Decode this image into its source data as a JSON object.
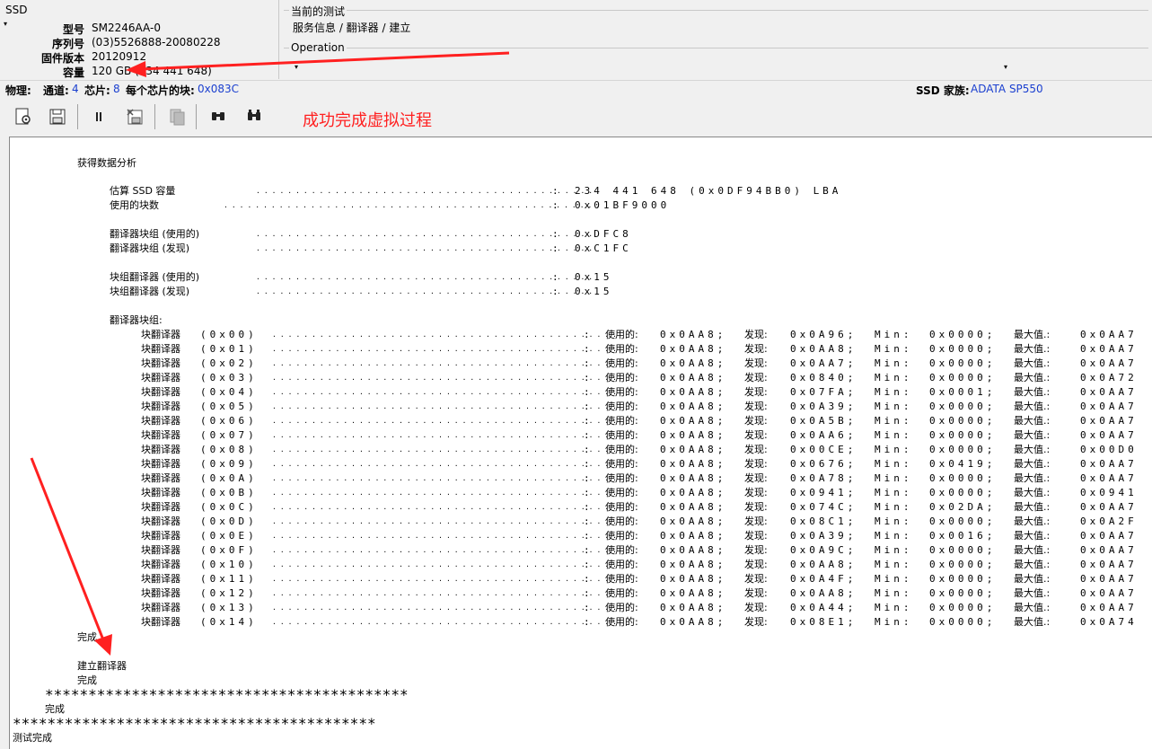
{
  "ssd": {
    "caption": "SSD",
    "dropdown_glyph": "▾",
    "fields": [
      {
        "label": "型号",
        "value": "SM2246AA-0"
      },
      {
        "label": "序列号",
        "value": "(03)5526888-20080228"
      },
      {
        "label": "固件版本",
        "value": "20120912"
      },
      {
        "label": "容量",
        "value": "120 GB (234 441 648)"
      }
    ]
  },
  "current_test": {
    "title": "当前的测试",
    "path": "服务信息 / 翻译器 / 建立"
  },
  "operation": {
    "title": "Operation",
    "selected": ""
  },
  "physical": {
    "label": "物理:",
    "channels_label": "通道:",
    "channels": "4",
    "chips_label": "芯片:",
    "chips": "8",
    "blocks_label": "每个芯片的块:",
    "blocks": "0x083C",
    "family_label": "SSD 家族:",
    "family": "ADATA SP550"
  },
  "toolbar": {
    "annotation": "成功完成虚拟过程",
    "annotation_color": "#ff2020"
  },
  "log": {
    "heading": "获得数据分析",
    "summary": [
      {
        "label": "估算 SSD 容量",
        "value": "234 441 648 (0x0DF94BB0) LBA"
      },
      {
        "label": "使用的块数",
        "value": "0x01BF9000"
      },
      {
        "label": "翻译器块组 (使用的)",
        "value": "0xDFC8"
      },
      {
        "label": "翻译器块组 (发现)",
        "value": "0xC1FC"
      },
      {
        "label": "块组翻译器 (使用的)",
        "value": "0x15"
      },
      {
        "label": "块组翻译器 (发现)",
        "value": "0x15"
      }
    ],
    "groups_heading": "翻译器块组:",
    "col_used": "使用的:",
    "col_found": "发现:",
    "col_min": "Min:",
    "col_max": "最大值.:",
    "translator_label": "块翻译器",
    "translators": [
      {
        "id": "(0x00)",
        "used": "0x0AA8;",
        "found": "0x0A96;",
        "min": "0x0000;",
        "max": "0x0AA7"
      },
      {
        "id": "(0x01)",
        "used": "0x0AA8;",
        "found": "0x0AA8;",
        "min": "0x0000;",
        "max": "0x0AA7"
      },
      {
        "id": "(0x02)",
        "used": "0x0AA8;",
        "found": "0x0AA7;",
        "min": "0x0000;",
        "max": "0x0AA7"
      },
      {
        "id": "(0x03)",
        "used": "0x0AA8;",
        "found": "0x0840;",
        "min": "0x0000;",
        "max": "0x0A72"
      },
      {
        "id": "(0x04)",
        "used": "0x0AA8;",
        "found": "0x07FA;",
        "min": "0x0001;",
        "max": "0x0AA7"
      },
      {
        "id": "(0x05)",
        "used": "0x0AA8;",
        "found": "0x0A39;",
        "min": "0x0000;",
        "max": "0x0AA7"
      },
      {
        "id": "(0x06)",
        "used": "0x0AA8;",
        "found": "0x0A5B;",
        "min": "0x0000;",
        "max": "0x0AA7"
      },
      {
        "id": "(0x07)",
        "used": "0x0AA8;",
        "found": "0x0AA6;",
        "min": "0x0000;",
        "max": "0x0AA7"
      },
      {
        "id": "(0x08)",
        "used": "0x0AA8;",
        "found": "0x00CE;",
        "min": "0x0000;",
        "max": "0x00D0"
      },
      {
        "id": "(0x09)",
        "used": "0x0AA8;",
        "found": "0x0676;",
        "min": "0x0419;",
        "max": "0x0AA7"
      },
      {
        "id": "(0x0A)",
        "used": "0x0AA8;",
        "found": "0x0A78;",
        "min": "0x0000;",
        "max": "0x0AA7"
      },
      {
        "id": "(0x0B)",
        "used": "0x0AA8;",
        "found": "0x0941;",
        "min": "0x0000;",
        "max": "0x0941"
      },
      {
        "id": "(0x0C)",
        "used": "0x0AA8;",
        "found": "0x074C;",
        "min": "0x02DA;",
        "max": "0x0AA7"
      },
      {
        "id": "(0x0D)",
        "used": "0x0AA8;",
        "found": "0x08C1;",
        "min": "0x0000;",
        "max": "0x0A2F"
      },
      {
        "id": "(0x0E)",
        "used": "0x0AA8;",
        "found": "0x0A39;",
        "min": "0x0016;",
        "max": "0x0AA7"
      },
      {
        "id": "(0x0F)",
        "used": "0x0AA8;",
        "found": "0x0A9C;",
        "min": "0x0000;",
        "max": "0x0AA7"
      },
      {
        "id": "(0x10)",
        "used": "0x0AA8;",
        "found": "0x0AA8;",
        "min": "0x0000;",
        "max": "0x0AA7"
      },
      {
        "id": "(0x11)",
        "used": "0x0AA8;",
        "found": "0x0A4F;",
        "min": "0x0000;",
        "max": "0x0AA7"
      },
      {
        "id": "(0x12)",
        "used": "0x0AA8;",
        "found": "0x0AA8;",
        "min": "0x0000;",
        "max": "0x0AA7"
      },
      {
        "id": "(0x13)",
        "used": "0x0AA8;",
        "found": "0x0A44;",
        "min": "0x0000;",
        "max": "0x0AA7"
      },
      {
        "id": "(0x14)",
        "used": "0x0AA8;",
        "found": "0x08E1;",
        "min": "0x0000;",
        "max": "0x0A74"
      }
    ],
    "done1": "完成",
    "build_translator": "建立翻译器",
    "done2": "完成",
    "stars1": "******************************************",
    "done3": "完成",
    "stars2": "******************************************",
    "test_done": "测试完成"
  }
}
